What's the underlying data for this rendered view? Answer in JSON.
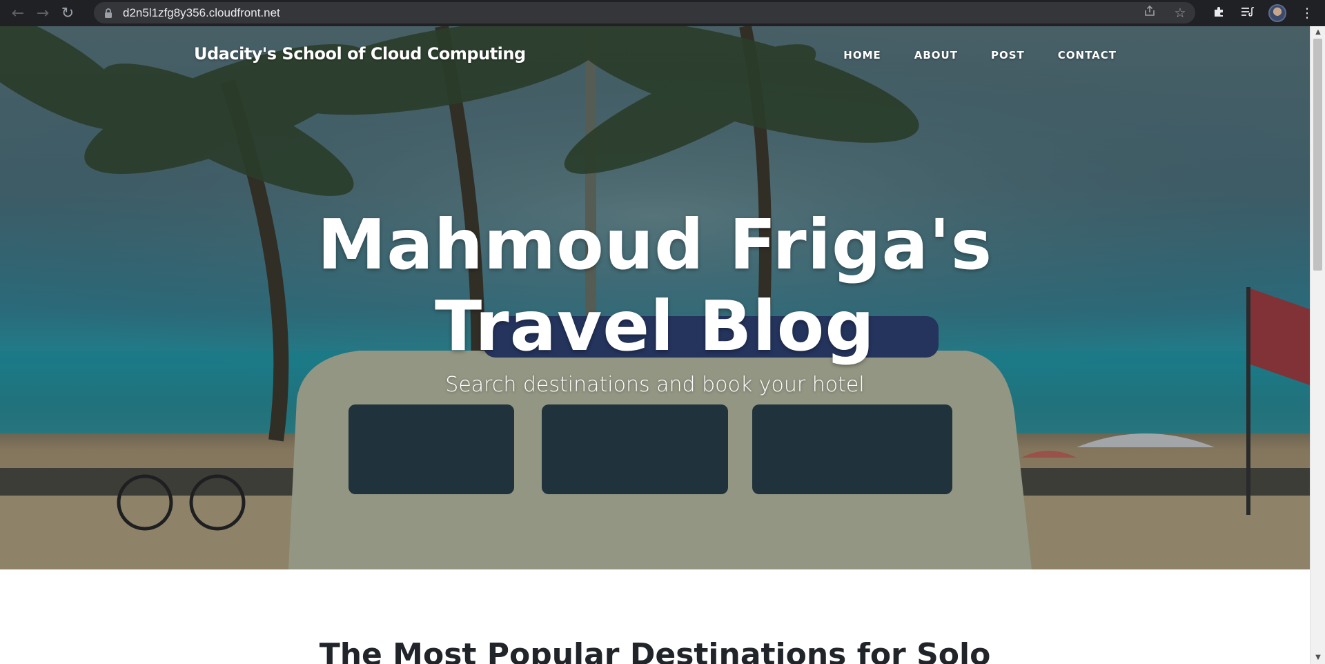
{
  "browser": {
    "url": "d2n5l1zfg8y356.cloudfront.net"
  },
  "site": {
    "brand": "Udacity's School of Cloud Computing",
    "nav": [
      {
        "label": "HOME"
      },
      {
        "label": "ABOUT"
      },
      {
        "label": "POST"
      },
      {
        "label": "CONTACT"
      }
    ],
    "hero": {
      "title_line1": "Mahmoud Friga's",
      "title_line2": "Travel Blog",
      "subtitle": "Search destinations and book your hotel"
    },
    "section_heading": "The Most Popular Destinations for Solo"
  },
  "icons": {
    "back": "back-arrow-icon",
    "forward": "forward-arrow-icon",
    "reload": "reload-icon",
    "lock": "lock-icon",
    "share": "share-icon",
    "bookmark": "star-icon",
    "extensions": "puzzle-icon",
    "reading_list": "reading-list-icon",
    "profile": "avatar",
    "menu": "kebab-menu-icon"
  }
}
